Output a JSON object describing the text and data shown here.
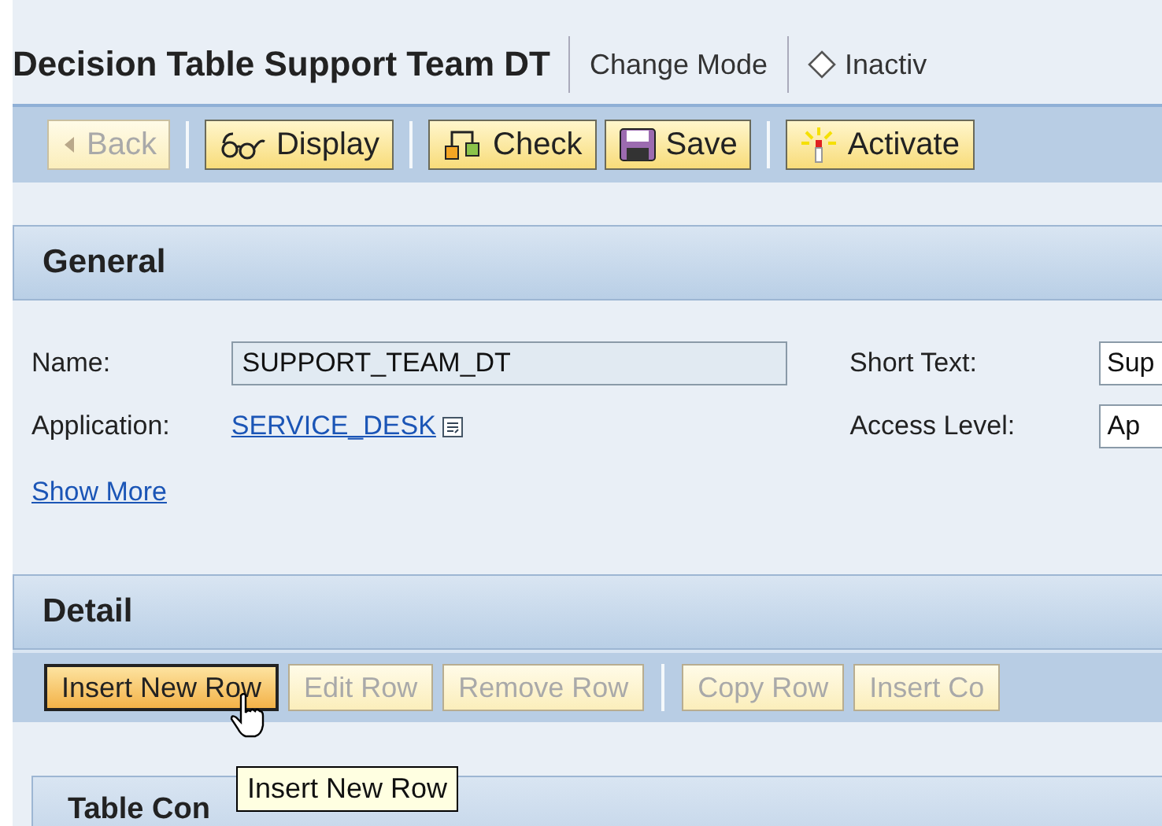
{
  "header": {
    "title": "Decision Table Support Team DT",
    "mode": "Change Mode",
    "status": "Inactiv"
  },
  "toolbar": [
    {
      "label": "Back",
      "kind": "back",
      "disabled": true
    },
    {
      "label": "Display",
      "kind": "display",
      "disabled": false
    },
    {
      "label": "Check",
      "kind": "check",
      "disabled": false
    },
    {
      "label": "Save",
      "kind": "save",
      "disabled": false
    },
    {
      "label": "Activate",
      "kind": "activate",
      "disabled": false
    }
  ],
  "general": {
    "title": "General",
    "name_label": "Name:",
    "name_value": "SUPPORT_TEAM_DT",
    "application_label": "Application:",
    "application_value": "SERVICE_DESK",
    "short_text_label": "Short Text:",
    "short_text_value": "Sup",
    "access_level_label": "Access Level:",
    "access_level_value": "Ap",
    "show_more": "Show More"
  },
  "detail": {
    "title": "Detail",
    "buttons": [
      {
        "label": "Insert New Row",
        "disabled": false,
        "selected": true
      },
      {
        "label": "Edit Row",
        "disabled": true,
        "selected": false
      },
      {
        "label": "Remove Row",
        "disabled": true,
        "selected": false
      },
      {
        "label": "Copy Row",
        "disabled": true,
        "selected": false
      },
      {
        "label": "Insert Co",
        "disabled": true,
        "selected": false
      }
    ],
    "table_title": "Table Con",
    "tooltip": "Insert New Row"
  }
}
